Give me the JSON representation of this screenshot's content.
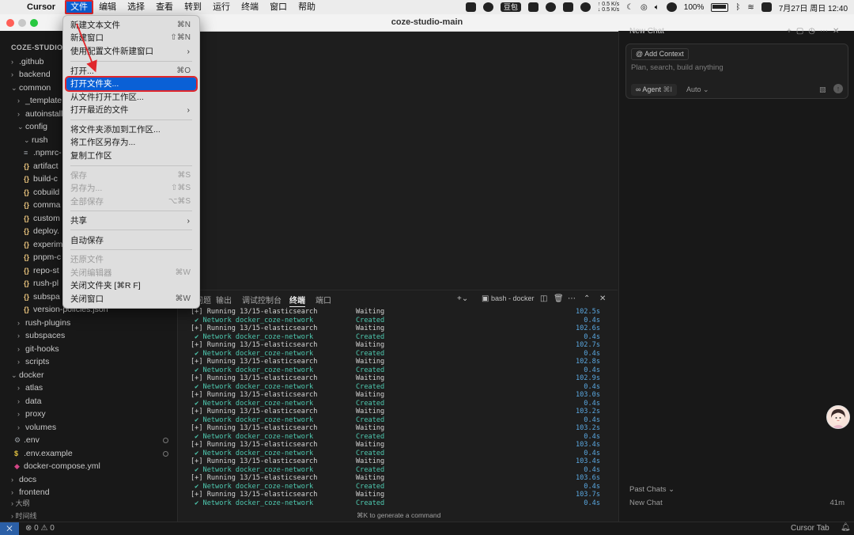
{
  "menubar": {
    "app_name": "Cursor",
    "menus": [
      "文件",
      "编辑",
      "选择",
      "查看",
      "转到",
      "运行",
      "终端",
      "窗口",
      "帮助"
    ],
    "tray_badge": "豆包",
    "net_up": "↑ 0.5 K/s",
    "net_down": "↓ 0.5 K/s",
    "battery": "100%",
    "datetime": "7月27日 周日  12:40"
  },
  "window": {
    "title": "coze-studio-main"
  },
  "file_menu": {
    "items": [
      {
        "label": "新建文本文件",
        "shortcut": "⌘N"
      },
      {
        "label": "新建窗口",
        "shortcut": "⇧⌘N"
      },
      {
        "label": "使用配置文件新建窗口",
        "submenu": "›"
      },
      {
        "label": "打开...",
        "shortcut": "⌘O"
      },
      {
        "label": "打开文件夹..."
      },
      {
        "label": "从文件打开工作区..."
      },
      {
        "label": "打开最近的文件",
        "submenu": "›"
      },
      {
        "label": "将文件夹添加到工作区..."
      },
      {
        "label": "将工作区另存为..."
      },
      {
        "label": "复制工作区"
      },
      {
        "label": "保存",
        "shortcut": "⌘S"
      },
      {
        "label": "另存为...",
        "shortcut": "⇧⌘S"
      },
      {
        "label": "全部保存",
        "shortcut": "⌥⌘S"
      },
      {
        "label": "共享",
        "submenu": "›"
      },
      {
        "label": "自动保存"
      },
      {
        "label": "还原文件"
      },
      {
        "label": "关闭编辑器",
        "shortcut": "⌘W"
      },
      {
        "label": "关闭文件夹 [⌘R F]"
      },
      {
        "label": "关闭窗口",
        "shortcut": "⌘W"
      }
    ]
  },
  "explorer": {
    "root": "COZE-STUDIO-",
    "items": [
      ".github",
      "backend",
      "common",
      "_template",
      "autoinstall",
      "config",
      "rush",
      ".npmrc-",
      "artifact",
      "build-c",
      "cobuild",
      "comma",
      "custom",
      "deploy.",
      "experim",
      "pnpm-c",
      "repo-st",
      "rush-pl",
      "subspa",
      "version-policies.json",
      "rush-plugins",
      "subspaces",
      "git-hooks",
      "scripts",
      "docker",
      "atlas",
      "data",
      "proxy",
      "volumes",
      ".env",
      ".env.example",
      "docker-compose.yml",
      "docs",
      "frontend"
    ],
    "outline_label": "大纲",
    "timeline_label": "时间线"
  },
  "terminal": {
    "tabs": [
      "问题",
      "输出",
      "调试控制台",
      "终端",
      "端口"
    ],
    "shell_label": "bash - docker",
    "lines": [
      {
        "text": "[+] Running 13/15-elasticsearch",
        "status": "Waiting",
        "time": "102.5s"
      },
      {
        "text": " ✔ Network docker_coze-network",
        "status": "Created",
        "time": "0.4s"
      },
      {
        "text": "[+] Running 13/15-elasticsearch",
        "status": "Waiting",
        "time": "102.6s"
      },
      {
        "text": " ✔ Network docker_coze-network",
        "status": "Created",
        "time": "0.4s"
      },
      {
        "text": "[+] Running 13/15-elasticsearch",
        "status": "Waiting",
        "time": "102.7s"
      },
      {
        "text": " ✔ Network docker_coze-network",
        "status": "Created",
        "time": "0.4s"
      },
      {
        "text": "[+] Running 13/15-elasticsearch",
        "status": "Waiting",
        "time": "102.8s"
      },
      {
        "text": " ✔ Network docker_coze-network",
        "status": "Created",
        "time": "0.4s"
      },
      {
        "text": "[+] Running 13/15-elasticsearch",
        "status": "Waiting",
        "time": "102.9s"
      },
      {
        "text": " ✔ Network docker_coze-network",
        "status": "Created",
        "time": "0.4s"
      },
      {
        "text": "[+] Running 13/15-elasticsearch",
        "status": "Waiting",
        "time": "103.0s"
      },
      {
        "text": " ✔ Network docker_coze-network",
        "status": "Created",
        "time": "0.4s"
      },
      {
        "text": "[+] Running 13/15-elasticsearch",
        "status": "Waiting",
        "time": "103.2s"
      },
      {
        "text": " ✔ Network docker_coze-network",
        "status": "Created",
        "time": "0.4s"
      },
      {
        "text": "[+] Running 13/15-elasticsearch",
        "status": "Waiting",
        "time": "103.2s"
      },
      {
        "text": " ✔ Network docker_coze-network",
        "status": "Created",
        "time": "0.4s"
      },
      {
        "text": "[+] Running 13/15-elasticsearch",
        "status": "Waiting",
        "time": "103.4s"
      },
      {
        "text": " ✔ Network docker_coze-network",
        "status": "Created",
        "time": "0.4s"
      },
      {
        "text": "[+] Running 13/15-elasticsearch",
        "status": "Waiting",
        "time": "103.4s"
      },
      {
        "text": " ✔ Network docker_coze-network",
        "status": "Created",
        "time": "0.4s"
      },
      {
        "text": "[+] Running 13/15-elasticsearch",
        "status": "Waiting",
        "time": "103.6s"
      },
      {
        "text": " ✔ Network docker_coze-network",
        "status": "Created",
        "time": "0.4s"
      },
      {
        "text": "[+] Running 13/15-elasticsearch",
        "status": "Waiting",
        "time": "103.7s"
      },
      {
        "text": " ✔ Network docker_coze-network",
        "status": "Created",
        "time": "0.4s"
      }
    ],
    "hint": "⌘K to generate a command"
  },
  "chat": {
    "title": "New Chat",
    "add_context": "Add Context",
    "placeholder": "Plan, search, build anything",
    "agent_label": "Agent",
    "agent_shortcut": "⌘I",
    "model_label": "Auto",
    "past_chats_label": "Past Chats",
    "past_items": [
      {
        "title": "New Chat",
        "age": "41m"
      }
    ]
  },
  "statusbar": {
    "problems": "0",
    "warnings": "0",
    "cursor_tab": "Cursor Tab"
  },
  "colors": {
    "accent": "#0a60d6",
    "annotation": "#e0262b",
    "terminal_time": "#5aa7e0",
    "terminal_ok": "#4ec9b0"
  }
}
